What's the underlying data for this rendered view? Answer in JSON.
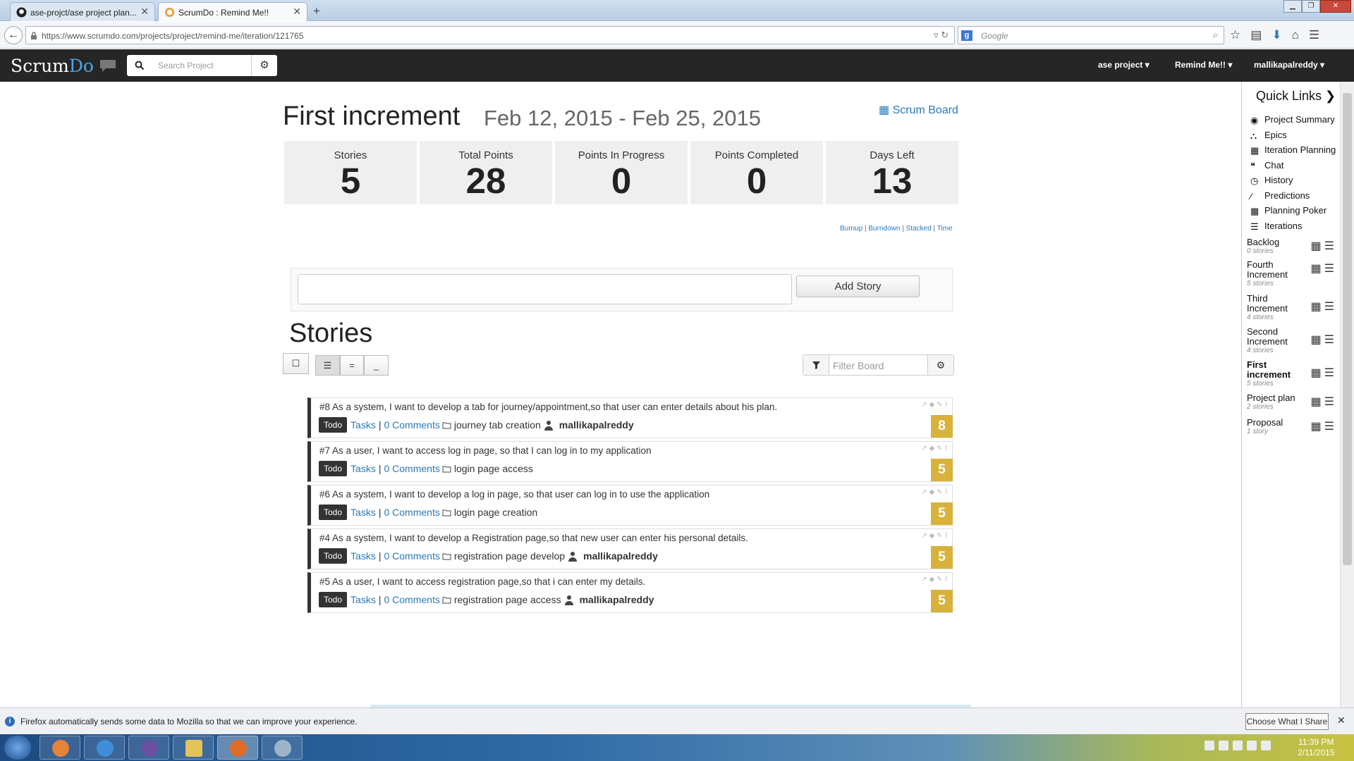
{
  "browser": {
    "tabs": [
      {
        "title": "ase-projct/ase project plan..."
      },
      {
        "title": "ScrumDo : Remind Me!!"
      }
    ],
    "url": "https://www.scrumdo.com/projects/project/remind-me/iteration/121765",
    "search_placeholder": "Google"
  },
  "appbar": {
    "logo_scrum": "Scrum",
    "logo_do": "Do",
    "search_placeholder": "Search Project",
    "menus": [
      "ase project",
      "Remind Me!!",
      "mallikapalreddy"
    ]
  },
  "iteration": {
    "title": "First increment",
    "dates": "Feb 12, 2015 - Feb 25, 2015",
    "scrum_board_label": "Scrum Board",
    "stats": [
      {
        "label": "Stories",
        "value": "5"
      },
      {
        "label": "Total Points",
        "value": "28"
      },
      {
        "label": "Points In Progress",
        "value": "0"
      },
      {
        "label": "Points Completed",
        "value": "0"
      },
      {
        "label": "Days Left",
        "value": "13"
      }
    ],
    "chart_links": [
      "Burnup",
      "Burndown",
      "Stacked",
      "Time"
    ],
    "chart_sep": "|"
  },
  "add_story": {
    "button": "Add Story"
  },
  "stories_heading": "Stories",
  "filter_placeholder": "Filter Board",
  "stories": [
    {
      "text": "#8 As a system, I want to develop a tab for journey/appointment,so that user can enter details about his plan.",
      "status": "Todo",
      "tasks": "Tasks",
      "sep": "|",
      "comments": "0 Comments",
      "epic": "journey tab creation",
      "assignee": "mallikapalreddy",
      "points": "8"
    },
    {
      "text": "#7 As a user, I want to access log in page, so that I can log in to my application",
      "status": "Todo",
      "tasks": "Tasks",
      "sep": "|",
      "comments": "0 Comments",
      "epic": "login page access",
      "assignee": "",
      "points": "5"
    },
    {
      "text": "#6 As a system, I want to develop a log in page, so that user can log in to use the application",
      "status": "Todo",
      "tasks": "Tasks",
      "sep": "|",
      "comments": "0 Comments",
      "epic": "login page creation",
      "assignee": "",
      "points": "5"
    },
    {
      "text": "#4 As a system, I want to develop a Registration page,so that new user can enter his personal details.",
      "status": "Todo",
      "tasks": "Tasks",
      "sep": "|",
      "comments": "0 Comments",
      "epic": "registration page develop",
      "assignee": "mallikapalreddy",
      "points": "5"
    },
    {
      "text": "#5 As a user, I want to access registration page,so that i can enter my details.",
      "status": "Todo",
      "tasks": "Tasks",
      "sep": "|",
      "comments": "0 Comments",
      "epic": "registration page access",
      "assignee": "mallikapalreddy",
      "points": "5"
    }
  ],
  "sidebar": {
    "title": "Quick Links",
    "links": [
      "Project Summary",
      "Epics",
      "Iteration Planning",
      "Chat",
      "History",
      "Predictions",
      "Planning Poker",
      "Iterations"
    ],
    "iterations": [
      {
        "name": "Backlog",
        "count": "0 stories"
      },
      {
        "name": "Fourth Increment",
        "count": "5 stories"
      },
      {
        "name": "Third Increment",
        "count": "4 stories"
      },
      {
        "name": "Second Increment",
        "count": "4 stories"
      },
      {
        "name": "First increment",
        "count": "5 stories"
      },
      {
        "name": "Project plan",
        "count": "2 stories"
      },
      {
        "name": "Proposal",
        "count": "1 story"
      }
    ]
  },
  "notification": {
    "text": "Firefox automatically sends some data to Mozilla so that we can improve your experience.",
    "button": "Choose What I Share"
  },
  "clock": {
    "time": "11:39 PM",
    "date": "2/11/2015"
  }
}
